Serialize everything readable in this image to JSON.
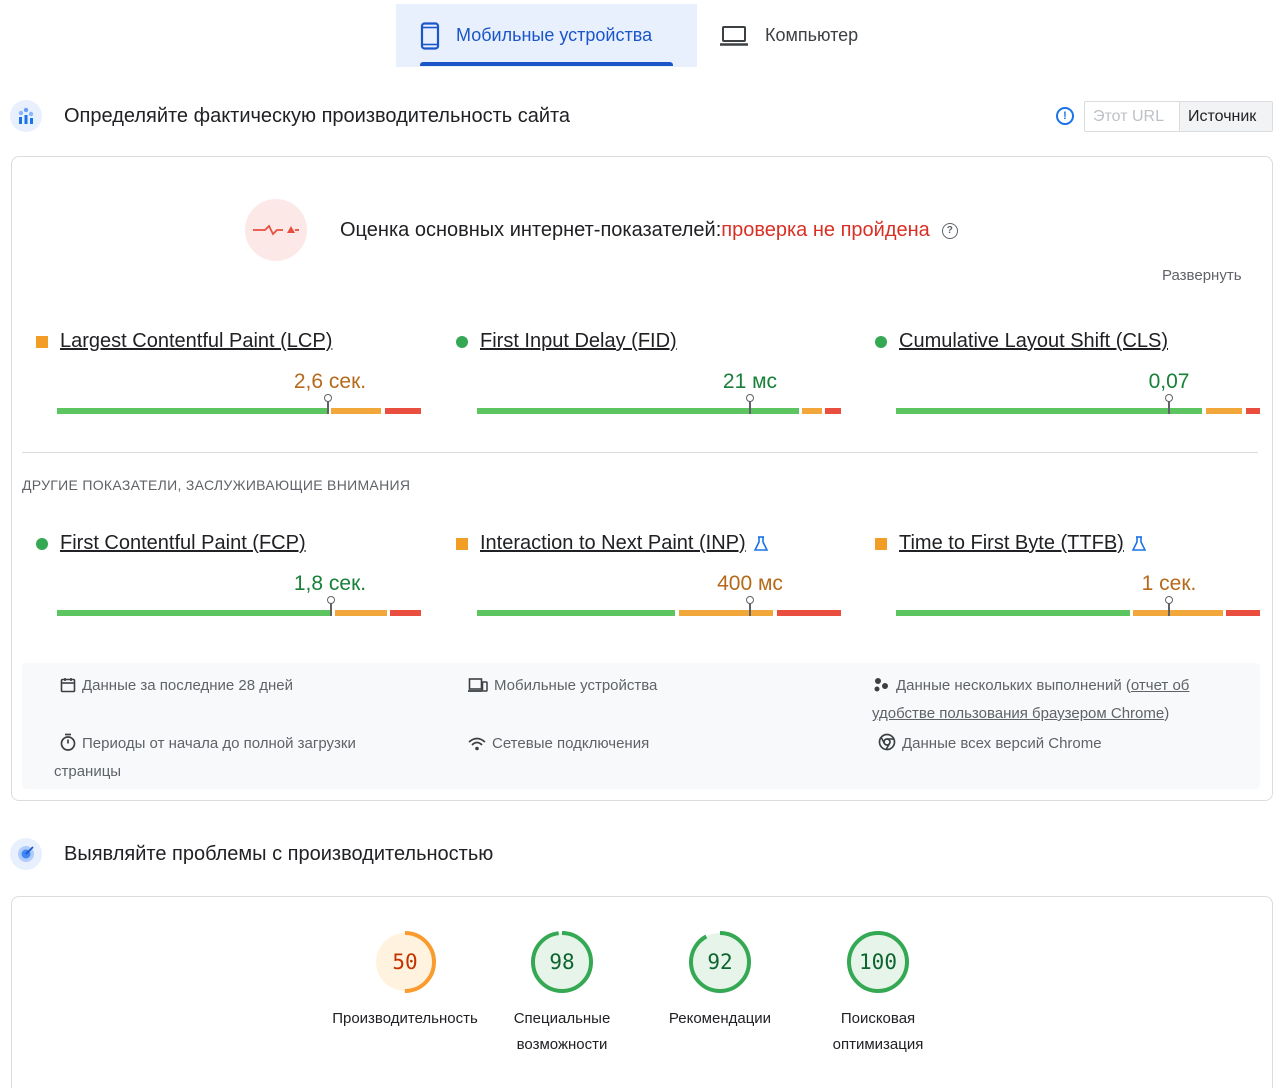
{
  "tabs": [
    {
      "label": "Мобильные устройства",
      "icon": "smartphone-icon",
      "active": true
    },
    {
      "label": "Компьютер",
      "icon": "laptop-icon",
      "active": false
    }
  ],
  "field": {
    "title": "Определяйте фактическую производительность сайта",
    "toggle": {
      "this_url": "Этот URL",
      "origin": "Источник"
    }
  },
  "assessment": {
    "label": "Оценка основных интернет-показателей:",
    "status": "проверка не пройдена",
    "expand": "Развернуть"
  },
  "core_metrics": [
    {
      "name": "Largest Contentful Paint (LCP)",
      "value": "2,6 сек.",
      "status": "average",
      "marker_fraction": 0.74
    },
    {
      "name": "First Input Delay (FID)",
      "value": "21 мс",
      "status": "good",
      "marker_fraction": 0.75
    },
    {
      "name": "Cumulative Layout Shift (CLS)",
      "value": "0,07",
      "status": "good",
      "marker_fraction": 0.75
    }
  ],
  "other_title": "ДРУГИЕ ПОКАЗАТЕЛИ, ЗАСЛУЖИВАЮЩИЕ ВНИМАНИЯ",
  "other_metrics": [
    {
      "name": "First Contentful Paint (FCP)",
      "value": "1,8 сек.",
      "status": "good",
      "marker_fraction": 0.75,
      "experimental": false
    },
    {
      "name": "Interaction to Next Paint (INP)",
      "value": "400 мс",
      "status": "average",
      "marker_fraction": 0.75,
      "experimental": true
    },
    {
      "name": "Time to First Byte (TTFB)",
      "value": "1 сек.",
      "status": "average",
      "marker_fraction": 0.75,
      "experimental": true
    }
  ],
  "footer": {
    "period": "Данные за последние 28 дней",
    "device": "Мобильные устройства",
    "samples_prefix": "Данные нескольких выполнений (",
    "samples_link1": "отчет об",
    "samples_link2": "удобстве пользования браузером Chrome",
    "samples_suffix": ")",
    "duration_line1": "Периоды от начала до полной загрузки",
    "duration_line2": "страницы",
    "network": "Сетевые подключения",
    "versions": "Данные всех версий Chrome"
  },
  "lab": {
    "title": "Выявляйте проблемы с производительностью",
    "scores": [
      {
        "score": "50",
        "label_line1": "Производительность",
        "label_line2": "",
        "fraction": 0.5,
        "color": "#fa9b2d"
      },
      {
        "score": "98",
        "label_line1": "Специальные",
        "label_line2": "возможности",
        "fraction": 0.98,
        "color": "#34a853"
      },
      {
        "score": "92",
        "label_line1": "Рекомендации",
        "label_line2": "",
        "fraction": 0.92,
        "color": "#34a853"
      },
      {
        "score": "100",
        "label_line1": "Поисковая",
        "label_line2": "оптимизация",
        "fraction": 1.0,
        "color": "#34a853"
      }
    ]
  },
  "colors": {
    "accent": "#1a56c8",
    "fail": "#d93025",
    "average": "#b56a1b",
    "good": "#188038"
  }
}
